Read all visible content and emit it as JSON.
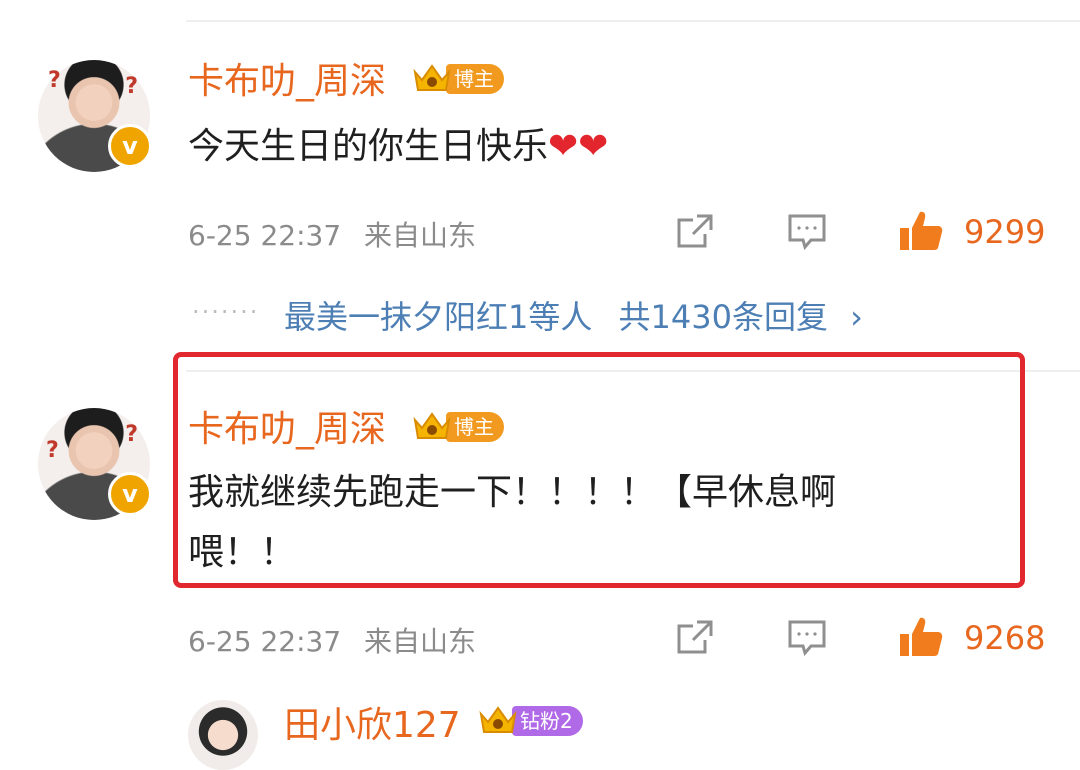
{
  "comments": [
    {
      "username": "卡布叻_周深",
      "badge": "博主",
      "text": "今天生日的你生日快乐",
      "hearts": "❤❤",
      "date": "6-25 22:37",
      "location": "来自山东",
      "likes": "9299",
      "replies": {
        "preview": "最美一抹夕阳红1等人",
        "count": "共1430条回复"
      }
    },
    {
      "username": "卡布叻_周深",
      "badge": "博主",
      "text_line1": "我就继续先跑走一下！！！！【早休息啊",
      "text_line2": "喂！！",
      "date": "6-25 22:37",
      "location": "来自山东",
      "likes": "9268"
    },
    {
      "username": "田小欣127",
      "badge": "钻粉2"
    }
  ],
  "colors": {
    "accent": "#e8671f",
    "link": "#4d7fb5",
    "highlight": "#e0282e"
  },
  "icons": [
    "share-icon",
    "comment-icon",
    "like-thumb-icon",
    "verified-badge-icon",
    "crown-icon",
    "chevron-right-icon"
  ]
}
